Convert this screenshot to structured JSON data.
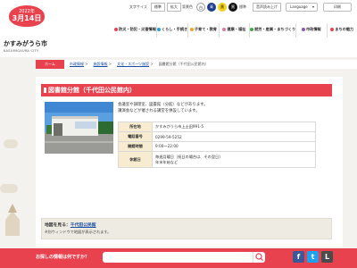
{
  "header": {
    "badge_year": "2022年",
    "badge_date": "3月14日",
    "site_name": "かすみがうら市",
    "site_roman": "KASUMIGAURA CITY",
    "font_size_label": "文字サイズ",
    "font_std": "標準",
    "font_large": "拡大",
    "bg_color_label": "背景色",
    "bg_options": [
      "白",
      "青",
      "黄",
      "黒"
    ],
    "bg_std": "標準",
    "reading": "音声読み上げ",
    "language": "Language",
    "print": "印刷"
  },
  "nav": [
    {
      "label": "防災・防犯・災害情報",
      "color": "#e8424f"
    },
    {
      "label": "くらし・手続き",
      "color": "#2aa0d8"
    },
    {
      "label": "子育て・教育",
      "color": "#f4a21f"
    },
    {
      "label": "健康・福祉",
      "color": "#e874a5"
    },
    {
      "label": "就労・産業・まちづくり",
      "color": "#41a64b"
    },
    {
      "label": "市政情報",
      "color": "#8a5ab1"
    },
    {
      "label": "まちの魅力",
      "color": "#e8424f"
    }
  ],
  "breadcrumb": {
    "home": "ホーム",
    "items": [
      "市政情報",
      "施設情報",
      "文化・スポーツ施設",
      "図書館分館（千代田公民館内）"
    ]
  },
  "page": {
    "title": "図書館分館（千代田公民館内）",
    "description": "会議室や調理室、図書館（分館）などがあります。\n講演会などが催される講堂を併設しています。"
  },
  "info_table": {
    "rows": [
      {
        "label": "所在地",
        "value": "かすみがうら市上土田991-5"
      },
      {
        "label": "電話番号",
        "value": "0299-59-5252"
      },
      {
        "label": "開館時間",
        "value": "9:00～22:00"
      },
      {
        "label": "休館日",
        "value_lines": [
          "毎週月曜日（祝日の場合は、その翌日）",
          "年末年始など"
        ]
      }
    ]
  },
  "map": {
    "title_prefix": "地図を見る：",
    "title_link": "千代田公民館",
    "subtitle": "※別ウィンドウで地図が表示されます。"
  },
  "footer": {
    "question": "お探しの情報は何ですか？",
    "social": [
      "f",
      "t",
      "L"
    ]
  },
  "colors": {
    "accent": "#e8424f",
    "link": "#1b4fa0",
    "table_head": "#f7ecd0"
  }
}
